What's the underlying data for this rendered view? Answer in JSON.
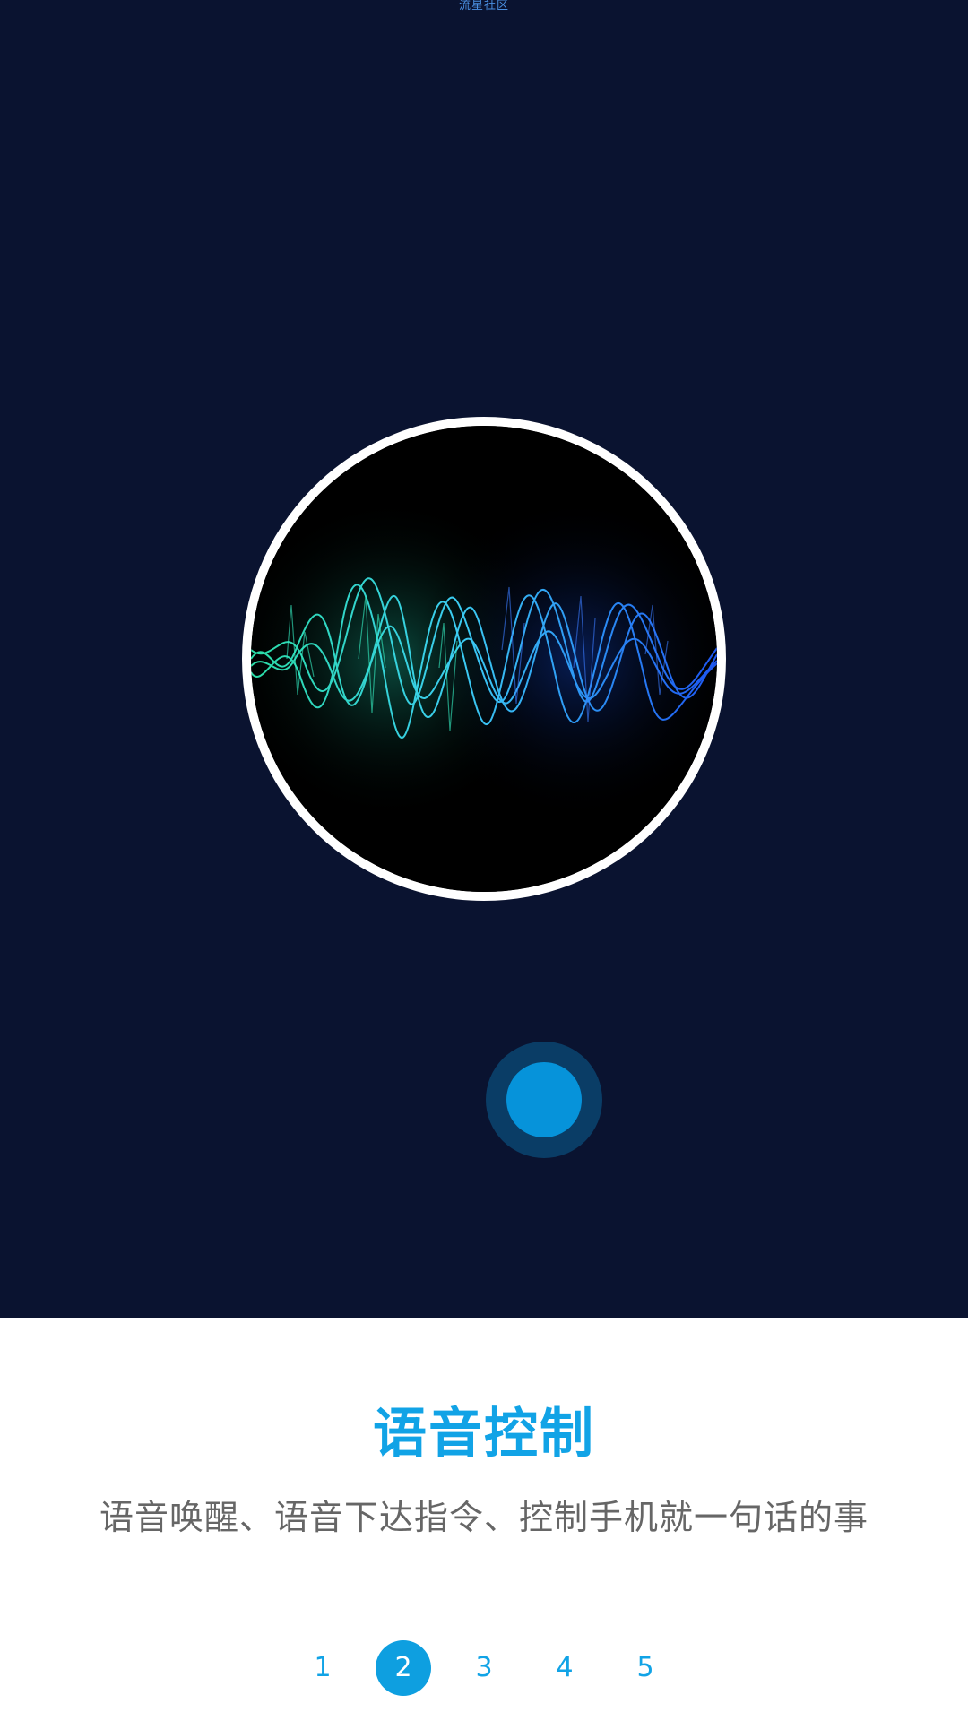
{
  "watermark": "流星社区",
  "hero": {
    "background": "#0a1330",
    "wave_image": "audio-waveform-illustration",
    "mic_button_color": "#0693da"
  },
  "feature": {
    "title": "语音控制",
    "description": "语音唤醒、语音下达指令、控制手机就一句话的事"
  },
  "pager": {
    "pages": [
      "1",
      "2",
      "3",
      "4",
      "5"
    ],
    "active_index": 1,
    "accent": "#11a3e6"
  }
}
